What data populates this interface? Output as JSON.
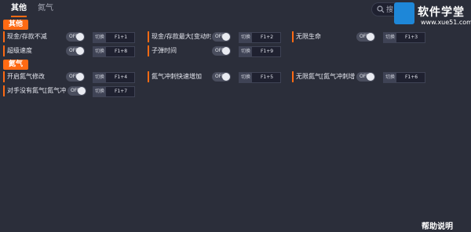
{
  "tabs": [
    {
      "label": "其他"
    },
    {
      "label": "氮气"
    }
  ],
  "search": {
    "placeholder": "搜"
  },
  "logo": {
    "brand": "软件学堂",
    "site": "www.xue51.com"
  },
  "sections": [
    {
      "title": "其他"
    },
    {
      "title": "氮气"
    }
  ],
  "rows": [
    {
      "label": "现金/存款不减",
      "toggle": "OFF",
      "key_prefix": "切换",
      "hotkey": "F1+1"
    },
    {
      "label": "现金/存款最大[变动时]",
      "toggle": "OFF",
      "key_prefix": "切换",
      "hotkey": "F1+2"
    },
    {
      "label": "无限生命",
      "toggle": "OFF",
      "key_prefix": "切换",
      "hotkey": "F1+3"
    },
    {
      "label": "超级速度",
      "toggle": "OFF",
      "key_prefix": "切换",
      "hotkey": "F1+8"
    },
    {
      "label": "子弹时间",
      "toggle": "OFF",
      "key_prefix": "切换",
      "hotkey": "F1+9"
    },
    {
      "label": "开启氮气修改",
      "toggle": "OFF",
      "key_prefix": "切换",
      "hotkey": "F1+4"
    },
    {
      "label": "氮气冲刺快速增加",
      "toggle": "OFF",
      "key_prefix": "切换",
      "hotkey": "F1+5"
    },
    {
      "label": "无限氮气[氮气冲刺增",
      "toggle": "OFF",
      "key_prefix": "切换",
      "hotkey": "F1+6"
    },
    {
      "label": "对手没有氮气[氮气冲...",
      "toggle": "OFF",
      "key_prefix": "切换",
      "hotkey": "F1+7"
    }
  ],
  "help": {
    "label": "帮助说明"
  }
}
